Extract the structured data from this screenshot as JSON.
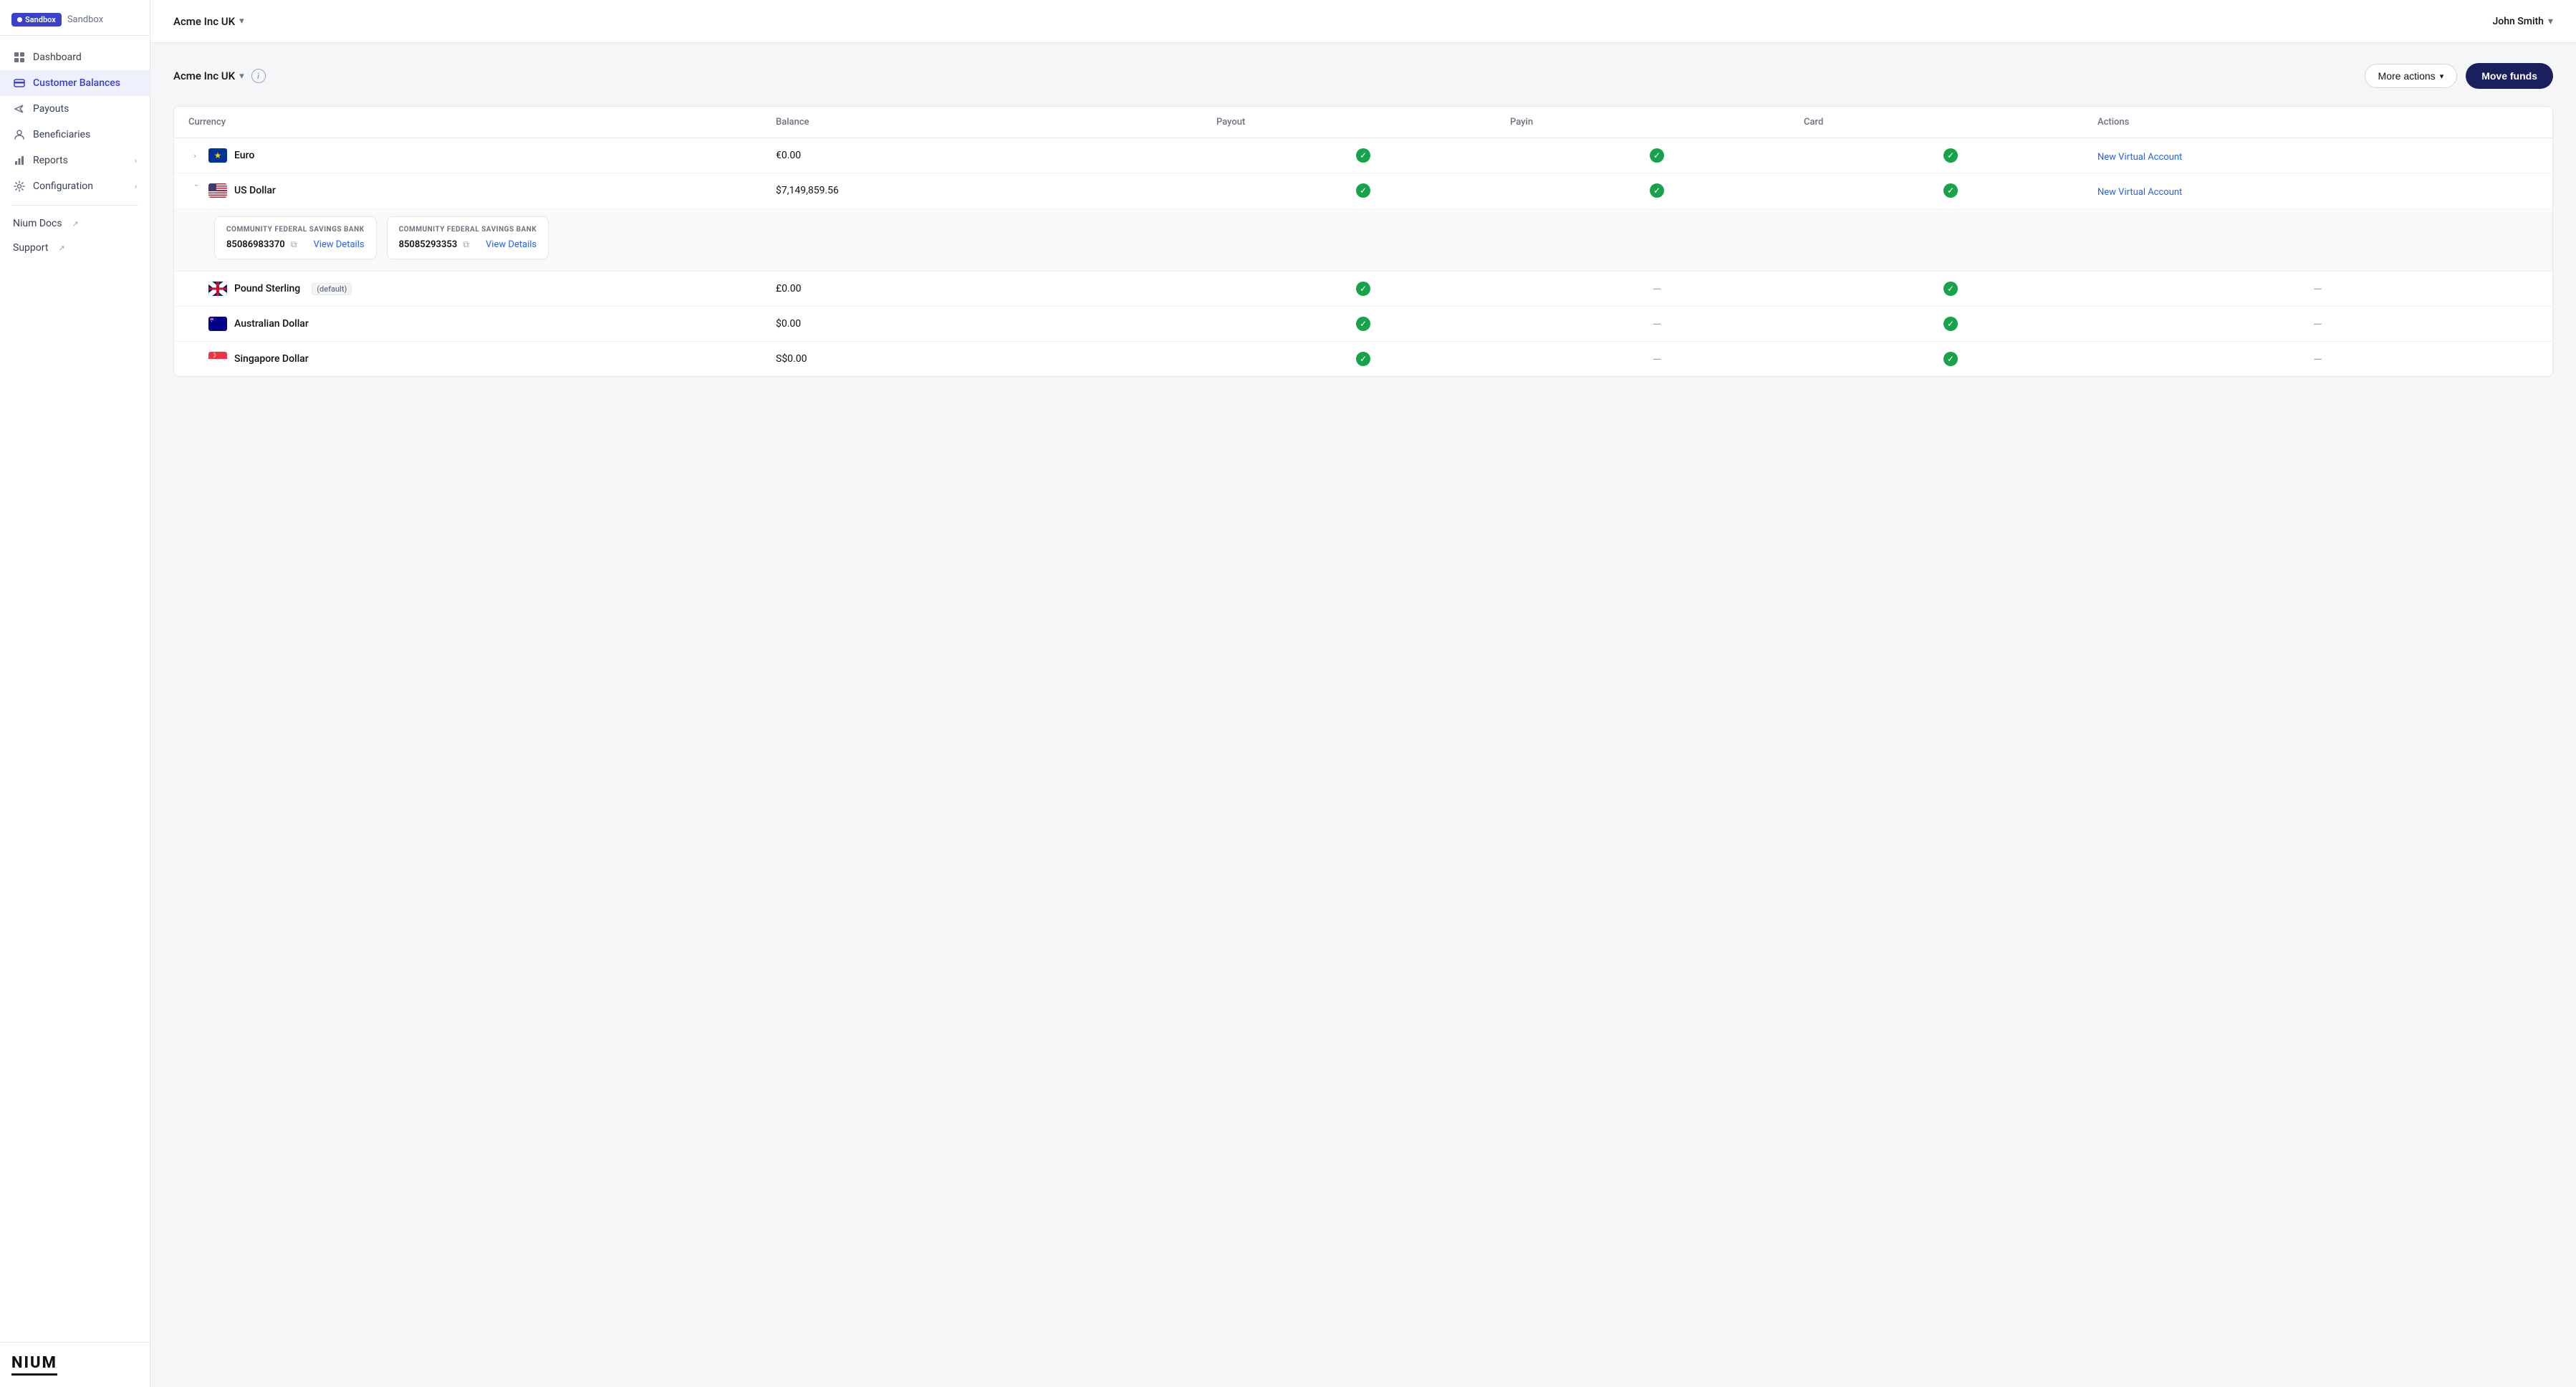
{
  "sidebar": {
    "sandbox_badge": "Sandbox",
    "sandbox_label": "Sandbox",
    "nav_items": [
      {
        "id": "dashboard",
        "label": "Dashboard",
        "icon": "grid"
      },
      {
        "id": "customer-balances",
        "label": "Customer Balances",
        "icon": "card",
        "active": true
      },
      {
        "id": "payouts",
        "label": "Payouts",
        "icon": "send"
      },
      {
        "id": "beneficiaries",
        "label": "Beneficiaries",
        "icon": "person"
      },
      {
        "id": "reports",
        "label": "Reports",
        "icon": "chart",
        "chevron": true
      },
      {
        "id": "configuration",
        "label": "Configuration",
        "icon": "settings",
        "chevron": true
      }
    ],
    "external_links": [
      {
        "id": "nium-docs",
        "label": "Nium Docs"
      },
      {
        "id": "support",
        "label": "Support"
      }
    ],
    "logo": "NIUM"
  },
  "header": {
    "org_name": "Acme Inc UK",
    "user_name": "John Smith"
  },
  "sub_header": {
    "org_name": "Acme Inc UK",
    "more_actions_label": "More actions",
    "move_funds_label": "Move funds"
  },
  "table": {
    "columns": [
      "Currency",
      "Balance",
      "Payout",
      "Payin",
      "Card",
      "Actions"
    ],
    "rows": [
      {
        "id": "eur",
        "currency": "Euro",
        "flag": "eu",
        "balance": "€0.00",
        "payout": true,
        "payin": true,
        "card": true,
        "action": "New Virtual Account",
        "expanded": false
      },
      {
        "id": "usd",
        "currency": "US Dollar",
        "flag": "us",
        "balance": "$7,149,859.56",
        "payout": true,
        "payin": true,
        "card": true,
        "action": "New Virtual Account",
        "expanded": true,
        "virtual_accounts": [
          {
            "bank": "COMMUNITY FEDERAL SAVINGS BANK",
            "account_number": "85086983370",
            "view_details_label": "View Details"
          },
          {
            "bank": "COMMUNITY FEDERAL SAVINGS BANK",
            "account_number": "85085293353",
            "view_details_label": "View Details"
          }
        ]
      },
      {
        "id": "gbp",
        "currency": "Pound Sterling",
        "flag": "gb",
        "balance": "£0.00",
        "payout": true,
        "payin": false,
        "card": true,
        "action": null,
        "default": true
      },
      {
        "id": "aud",
        "currency": "Australian Dollar",
        "flag": "au",
        "balance": "$0.00",
        "payout": true,
        "payin": false,
        "card": true,
        "action": null
      },
      {
        "id": "sgd",
        "currency": "Singapore Dollar",
        "flag": "sg",
        "balance": "S$0.00",
        "payout": true,
        "payin": false,
        "card": true,
        "action": null
      }
    ]
  }
}
